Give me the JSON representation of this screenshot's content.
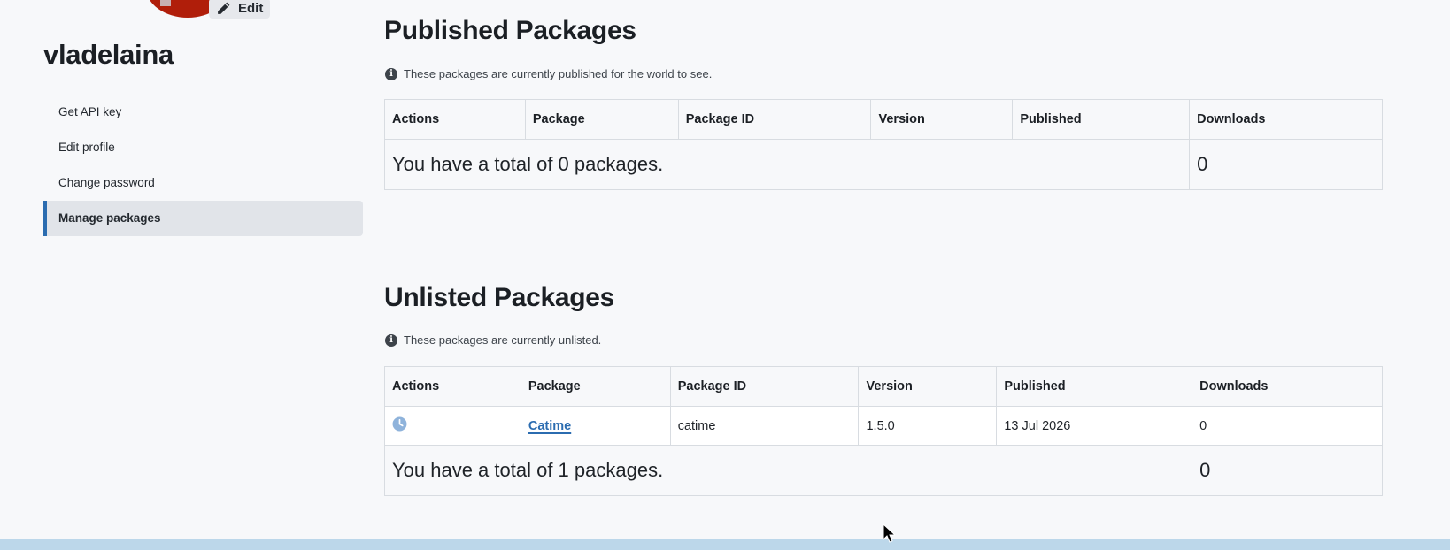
{
  "sidebar": {
    "edit_label": "Edit",
    "username": "vladelaina",
    "items": [
      {
        "label": "Get API key"
      },
      {
        "label": "Edit profile"
      },
      {
        "label": "Change password"
      },
      {
        "label": "Manage packages",
        "active": true
      }
    ]
  },
  "published": {
    "title": "Published Packages",
    "note": "These packages are currently published for the world to see.",
    "columns": [
      "Actions",
      "Package",
      "Package ID",
      "Version",
      "Published",
      "Downloads"
    ],
    "rows": [],
    "total_text": "You have a total of 0 packages.",
    "total_downloads": "0"
  },
  "unlisted": {
    "title": "Unlisted Packages",
    "note": "These packages are currently unlisted.",
    "columns": [
      "Actions",
      "Package",
      "Package ID",
      "Version",
      "Published",
      "Downloads"
    ],
    "rows": [
      {
        "action_icon": "clock-icon",
        "package": "Catime",
        "package_id": "catime",
        "version": "1.5.0",
        "published": "13 Jul 2026",
        "downloads": "0"
      }
    ],
    "total_text": "You have a total of 1 packages.",
    "total_downloads": "0"
  },
  "colors": {
    "accent": "#2b6cb0",
    "avatar": "#b01e0a",
    "footer": "#bcd7ea"
  }
}
